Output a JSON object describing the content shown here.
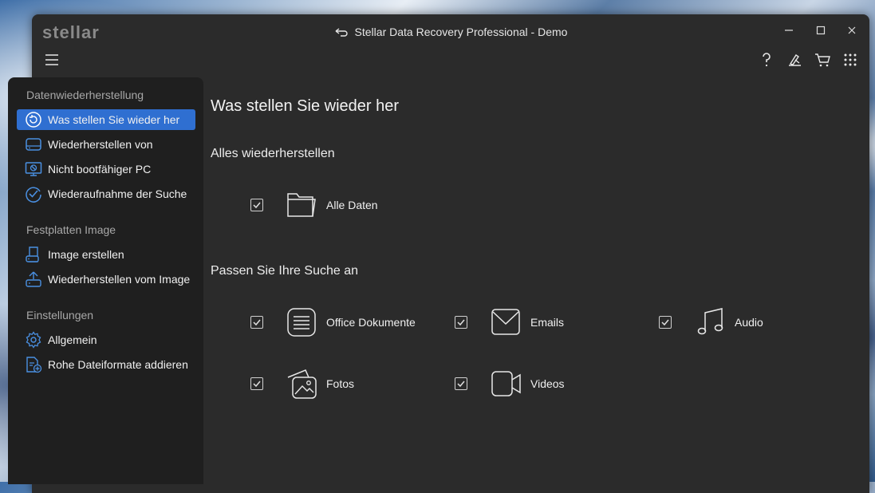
{
  "window": {
    "logo": "stellar",
    "title": "Stellar Data Recovery Professional - Demo"
  },
  "toolbar": {
    "icons": [
      "menu-icon",
      "help-icon",
      "tools-icon",
      "cart-icon",
      "apps-grid-icon"
    ]
  },
  "sidebar": {
    "sections": [
      {
        "title": "Datenwiederherstellung",
        "items": [
          {
            "label": "Was stellen Sie wieder her",
            "icon": "restore-icon",
            "active": true
          },
          {
            "label": "Wiederherstellen von",
            "icon": "drive-icon"
          },
          {
            "label": "Nicht bootfähiger PC",
            "icon": "monitor-blocked-icon"
          },
          {
            "label": "Wiederaufnahme der Suche",
            "icon": "resume-scan-icon"
          }
        ]
      },
      {
        "title": "Festplatten Image",
        "items": [
          {
            "label": "Image erstellen",
            "icon": "disk-image-create-icon"
          },
          {
            "label": "Wiederherstellen vom Image",
            "icon": "disk-image-restore-icon"
          }
        ]
      },
      {
        "title": "Einstellungen",
        "items": [
          {
            "label": "Allgemein",
            "icon": "gear-icon"
          },
          {
            "label": "Rohe Dateiformate addieren",
            "icon": "file-add-icon"
          }
        ]
      }
    ]
  },
  "main": {
    "heading": "Was stellen Sie wieder her",
    "all_section": {
      "title": "Alles wiederherstellen",
      "option": {
        "label": "Alle Daten",
        "checked": true,
        "icon": "folder-icon"
      }
    },
    "custom_section": {
      "title": "Passen Sie Ihre Suche an",
      "options": [
        {
          "label": "Office Dokumente",
          "checked": true,
          "icon": "document-icon"
        },
        {
          "label": "Emails",
          "checked": true,
          "icon": "email-icon"
        },
        {
          "label": "Audio",
          "checked": true,
          "icon": "music-note-icon"
        },
        {
          "label": "Fotos",
          "checked": true,
          "icon": "photos-icon"
        },
        {
          "label": "Videos",
          "checked": true,
          "icon": "video-icon"
        }
      ]
    }
  },
  "colors": {
    "accent": "#2f6fd1",
    "window_bg": "#2b2b2b",
    "sidebar_bg": "#1f1f1f",
    "icon_blue": "#4a90e2"
  }
}
